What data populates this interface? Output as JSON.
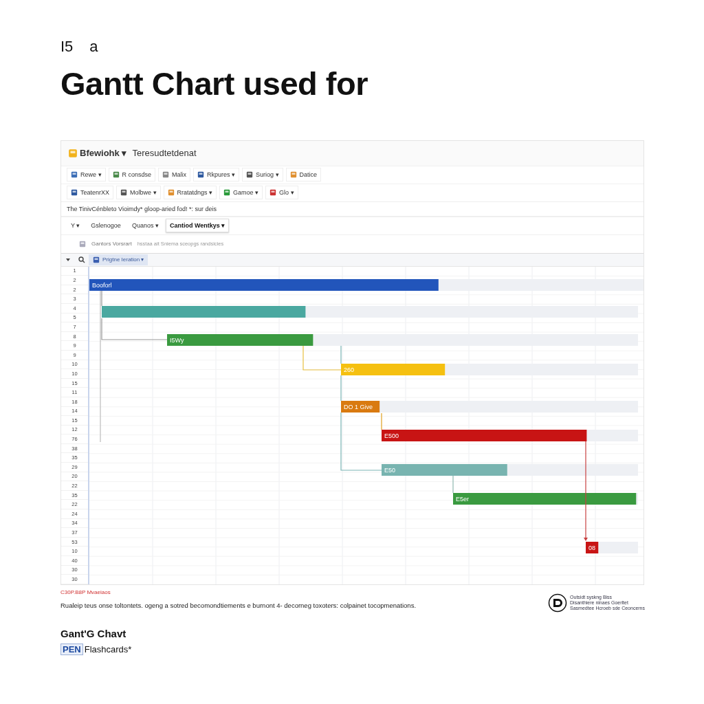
{
  "card": {
    "kicker": [
      "I5",
      "a"
    ],
    "title": "Gantt Chart used for"
  },
  "app": {
    "title_bar": {
      "app_name": "Bfewiohk ▾",
      "document": "Teresudtetdenat"
    },
    "toolbar_rows": [
      [
        {
          "label": "Rewe ▾"
        },
        {
          "label": "R consdse"
        },
        {
          "label": "Malix"
        },
        {
          "label": "Rkpures ▾"
        },
        {
          "label": "Suriog ▾"
        },
        {
          "label": "Datice"
        }
      ],
      [
        {
          "label": "TeatenrXX"
        },
        {
          "label": "Molbwe ▾"
        },
        {
          "label": "Rratatdngs ▾"
        },
        {
          "label": "Gamoe ▾"
        },
        {
          "label": "Glo ▾"
        }
      ]
    ],
    "formula_bar": "The TinivCénbleto Vioimdy* gloop-aried fod! *: sur deis",
    "view_bar": [
      {
        "label": "Y ▾",
        "selected": false
      },
      {
        "label": "Gslenogoe",
        "selected": false
      },
      {
        "label": "Quanos ▾",
        "selected": false
      },
      {
        "label": "Cantiod Wentkys ▾",
        "selected": true
      }
    ],
    "breadcrumb": {
      "label": "Gantors Vorsrart",
      "detail": "hsstaa ait Sniema sceopgs randsicies"
    },
    "chart_header": {
      "dropdown": "Prigtne Ieration ▾"
    },
    "row_numbers": [
      "1",
      "2",
      "2",
      "3",
      "4",
      "5",
      "7",
      "8",
      "9",
      "9",
      "10",
      "10",
      "15",
      "11",
      "18",
      "14",
      "15",
      "12",
      "76",
      "38",
      "35",
      "29",
      "20",
      "22",
      "35",
      "22",
      "24",
      "34",
      "37",
      "53",
      "10",
      "40",
      "30",
      "30"
    ],
    "tasks": [
      {
        "label": "Booforl",
        "color": "#2255bb",
        "level": 0.63
      },
      {
        "color": "#4aa8a0",
        "level": 0.38
      },
      {
        "label": "I5Wy",
        "color": "#3a9a40",
        "level": 0.31
      },
      {
        "label": "260",
        "color": "#f5c010",
        "level": 0.35
      },
      {
        "label": "DO 1 Give",
        "color": "#d97a10",
        "level": 0.13
      },
      {
        "label": "E500",
        "color": "#c81414",
        "level": 0.8
      },
      {
        "label": "E50",
        "color": "#78b4b0",
        "level": 0.49
      },
      {
        "label": "E5er",
        "color": "#3a9a40",
        "level": 0.99
      },
      {
        "label": "08",
        "color": "#c81414",
        "level": 0.24
      }
    ]
  },
  "footer": {
    "note": "C30P.B8P Mvaeiaos",
    "description": "Rualeip teus onse toltontets. ogeng a sotred becomondtiements e burnont 4- decorneg toxoters: colpainet tocopmenations.",
    "badge_lines": [
      "Outsidt syskng Biss",
      "Disanthiere ninaes Goerltet",
      "Sasmedtee Hcroeb sde Ceoncerns"
    ]
  },
  "brand": {
    "title": "Gant'G Chavt",
    "logo": "PEN",
    "name": "Flashcards*"
  }
}
